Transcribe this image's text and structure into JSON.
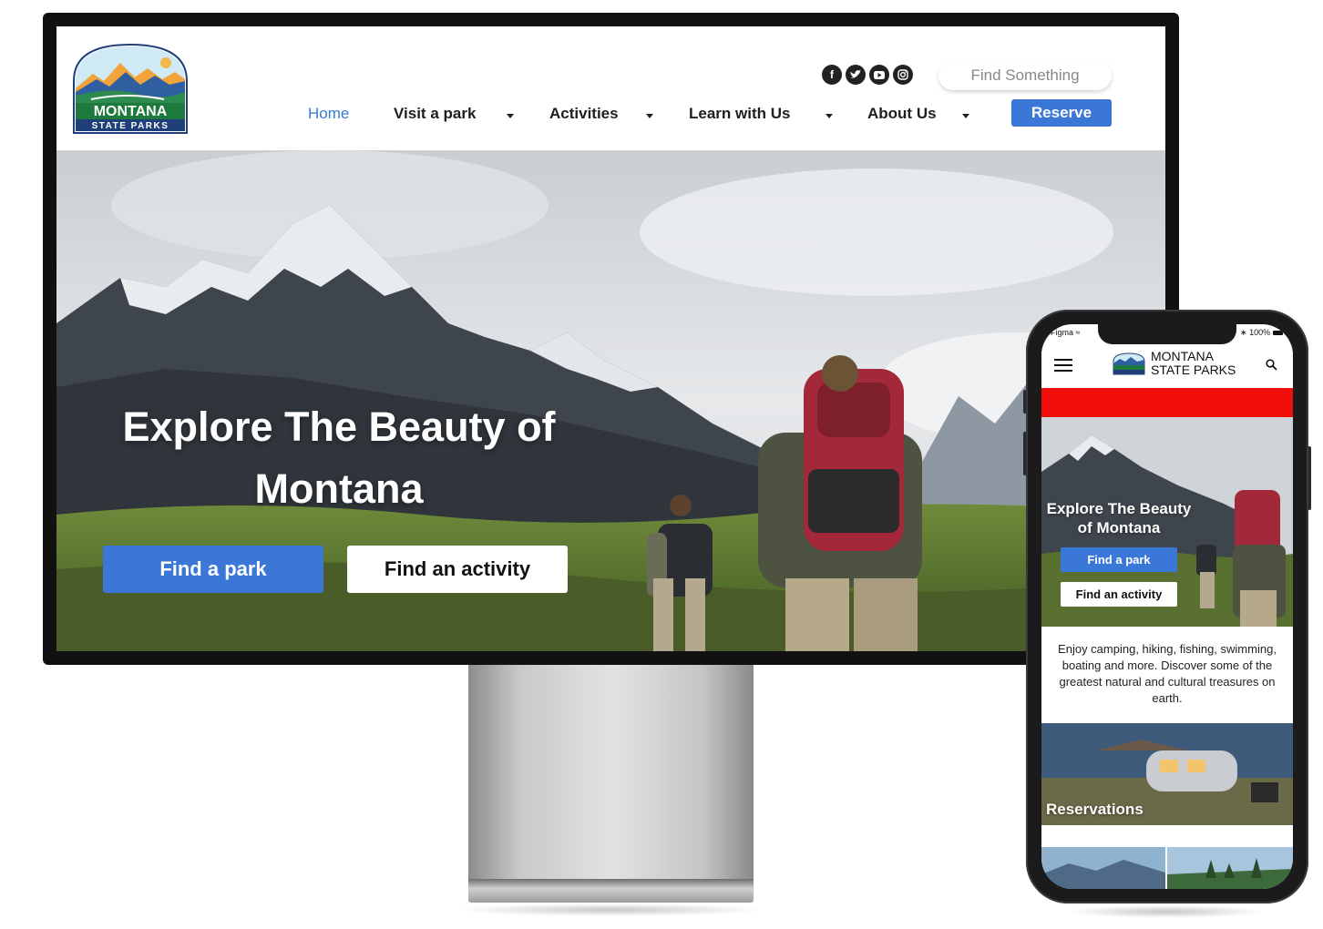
{
  "desktop": {
    "logo": {
      "line1": "MONTANA",
      "line2": "STATE PARKS"
    },
    "social_icons": [
      "facebook-icon",
      "twitter-icon",
      "youtube-icon",
      "instagram-icon"
    ],
    "search": {
      "placeholder": "Find Something"
    },
    "nav": [
      {
        "label": "Home",
        "active": true
      },
      {
        "label": "Visit a park",
        "dropdown": true
      },
      {
        "label": "Activities",
        "dropdown": true
      },
      {
        "label": "Learn with Us",
        "dropdown": true
      },
      {
        "label": "About Us",
        "dropdown": true
      }
    ],
    "reserve_label": "Reserve",
    "hero": {
      "title_line1": "Explore The Beauty of",
      "title_line2": "Montana",
      "find_park_label": "Find a park",
      "find_activity_label": "Find an activity"
    }
  },
  "mobile": {
    "status": {
      "carrier": "Figma",
      "battery": "100%"
    },
    "brand_line1": "MONTANA",
    "brand_line2": "STATE PARKS",
    "hero": {
      "title_line1": "Explore The Beauty",
      "title_line2": "of Montana",
      "find_park_label": "Find a park",
      "find_activity_label": "Find an activity"
    },
    "intro_text": "Enjoy camping, hiking, fishing, swimming, boating and more. Discover some of the greatest natural and cultural treasures on earth.",
    "reservations_label": "Reservations"
  },
  "colors": {
    "accent_blue": "#3a77d6",
    "mobile_banner_red": "#f20d0d",
    "logo_green": "#1e7a3c",
    "logo_navy": "#1f3f7a"
  }
}
